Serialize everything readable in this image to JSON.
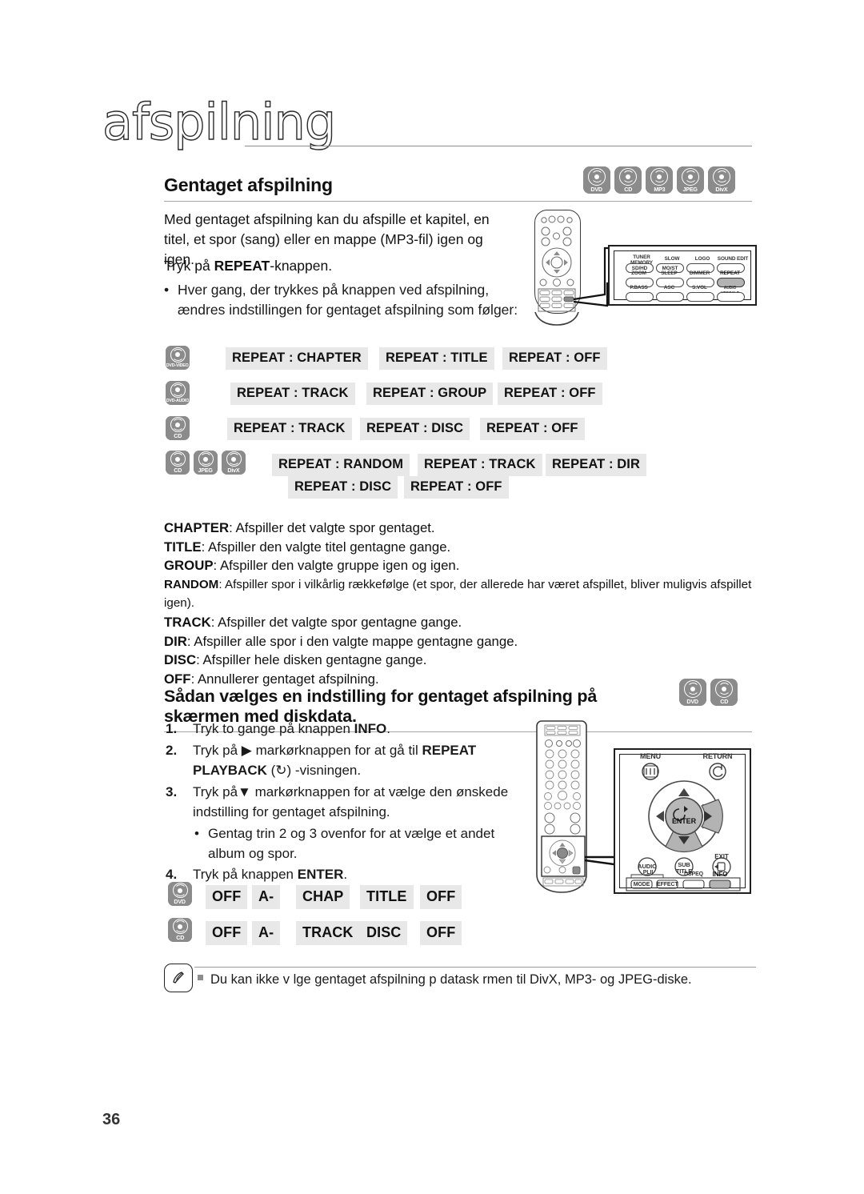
{
  "masthead": {
    "title": "afspilning"
  },
  "page_number": "36",
  "section1": {
    "heading": "Gentaget afspilning",
    "badges": [
      "DVD",
      "CD",
      "MP3",
      "JPEG",
      "DivX"
    ],
    "intro": "Med gentaget afspilning kan du afspille et kapitel, en titel, et spor (sang) eller en mappe (MP3-fil) igen og igen.",
    "press": {
      "pre": "Tryk på ",
      "key": "REPEAT",
      "post": "-knappen."
    },
    "bullet": "Hver gang, der trykkes på knappen ved afspilning, ændres indstillingen for gentaget afspilning som følger:",
    "rows": [
      {
        "discs": [
          {
            "label": "DVD-VIDEO",
            "tiny": true
          }
        ],
        "chips": [
          "REPEAT : CHAPTER",
          "REPEAT : TITLE",
          "REPEAT : OFF"
        ]
      },
      {
        "discs": [
          {
            "label": "DVD-AUDIO",
            "tiny": true
          }
        ],
        "chips": [
          "REPEAT : TRACK",
          "REPEAT : GROUP",
          "REPEAT : OFF"
        ]
      },
      {
        "discs": [
          {
            "label": "CD",
            "tiny": false
          }
        ],
        "chips": [
          "REPEAT : TRACK",
          "REPEAT : DISC",
          "REPEAT : OFF"
        ]
      },
      {
        "discs": [
          {
            "label": "CD",
            "tiny": false
          },
          {
            "label": "JPEG",
            "tiny": false
          },
          {
            "label": "DivX",
            "tiny": false
          }
        ],
        "chips": [
          "REPEAT : RANDOM",
          "REPEAT : TRACK",
          "REPEAT : DIR"
        ]
      }
    ],
    "row4_second_line": [
      "REPEAT : DISC",
      "REPEAT : OFF"
    ],
    "definitions": [
      {
        "term": "CHAPTER",
        "text": ": Afspiller det valgte spor gentaget."
      },
      {
        "term": "TITLE",
        "text": ": Afspiller den valgte titel gentagne gange."
      },
      {
        "term": "GROUP",
        "text": ": Afspiller den valgte gruppe igen og igen."
      },
      {
        "term": "RANDOM",
        "text": ": Afspiller spor i vilkårlig rækkefølge (et spor, der allerede har været afspillet, bliver muligvis afspillet igen)."
      },
      {
        "term": "TRACK",
        "text": ": Afspiller det valgte spor gentagne gange."
      },
      {
        "term": "DIR",
        "text": ": Afspiller alle spor i den valgte mappe gentagne gange."
      },
      {
        "term": "DISC",
        "text": ": Afspiller hele disken gentagne gange."
      },
      {
        "term": "OFF",
        "text": ": Annullerer gentaget afspilning."
      }
    ]
  },
  "section2": {
    "heading": "Sådan vælges en indstilling for gentaget afspilning på skærmen med diskdata.",
    "badges": [
      "DVD",
      "CD"
    ],
    "steps": [
      {
        "num": "1.",
        "parts": [
          {
            "t": "Tryk to gange på knappen ",
            "b": false
          },
          {
            "t": "INFO",
            "b": true
          },
          {
            "t": ".",
            "b": false
          }
        ]
      },
      {
        "num": "2.",
        "parts": [
          {
            "t": "Tryk på ",
            "b": false
          },
          {
            "t": "▶",
            "b": false
          },
          {
            "t": " markørknappen for at gå til ",
            "b": false
          },
          {
            "t": "REPEAT PLAYBACK",
            "b": true
          },
          {
            "t": " (↻) -visningen.",
            "b": false
          }
        ]
      },
      {
        "num": "3.",
        "parts": [
          {
            "t": "Tryk på",
            "b": false
          },
          {
            "t": "▼",
            "b": false
          },
          {
            "t": " markørknappen  for at vælge den ønskede indstilling for gentaget afspilning.",
            "b": false
          }
        ]
      }
    ],
    "sub_bullet": "Gentag trin 2 og 3 ovenfor for at vælge et andet album og spor.",
    "step4": {
      "num": "4.",
      "pre": "Tryk på knappen ",
      "key": "ENTER",
      "post": "."
    },
    "state_rows": [
      {
        "disc": "DVD",
        "chips": [
          "OFF",
          "A-",
          "CHAP",
          "TITLE",
          "OFF"
        ]
      },
      {
        "disc": "CD",
        "chips": [
          "OFF",
          "A-",
          "TRACK",
          "DISC",
          "OFF"
        ]
      }
    ]
  },
  "note": {
    "text": "Du kan ikke v lge gentaget afspilning p  datask rmen til DivX, MP3- og JPEG-diske."
  },
  "remote_top": {
    "callout_labels_row1": [
      "TUNER MEMORY",
      "SLOW",
      "LOGO",
      "SOUND EDIT"
    ],
    "callout_keys_row1": [
      "SD/HD",
      "MO/ST",
      "",
      ""
    ],
    "callout_labels_row2": [
      "ZOOM",
      "SLEEP",
      "DIMMER",
      "REPEAT"
    ],
    "callout_labels_row3": [
      "P.BASS",
      "ASC",
      "S.VOL",
      "AUDIO UPSCALE"
    ],
    "highlighted": "REPEAT"
  },
  "remote_bottom": {
    "menu": "MENU",
    "return": "RETURN",
    "enter": "ENTER",
    "audio": "AUDIO",
    "subtitle": "SUB TITLE",
    "exit": "EXIT",
    "mode": "MODE",
    "effect": "EFFECT",
    "plii": "PLII",
    "dspeq": "DSPEQ",
    "info": "INFO",
    "highlighted": "INFO"
  },
  "colors": {
    "chip_bg": "#e8e8e8",
    "badge_bg": "#8b8b8b",
    "rule": "#a6a6a6"
  }
}
